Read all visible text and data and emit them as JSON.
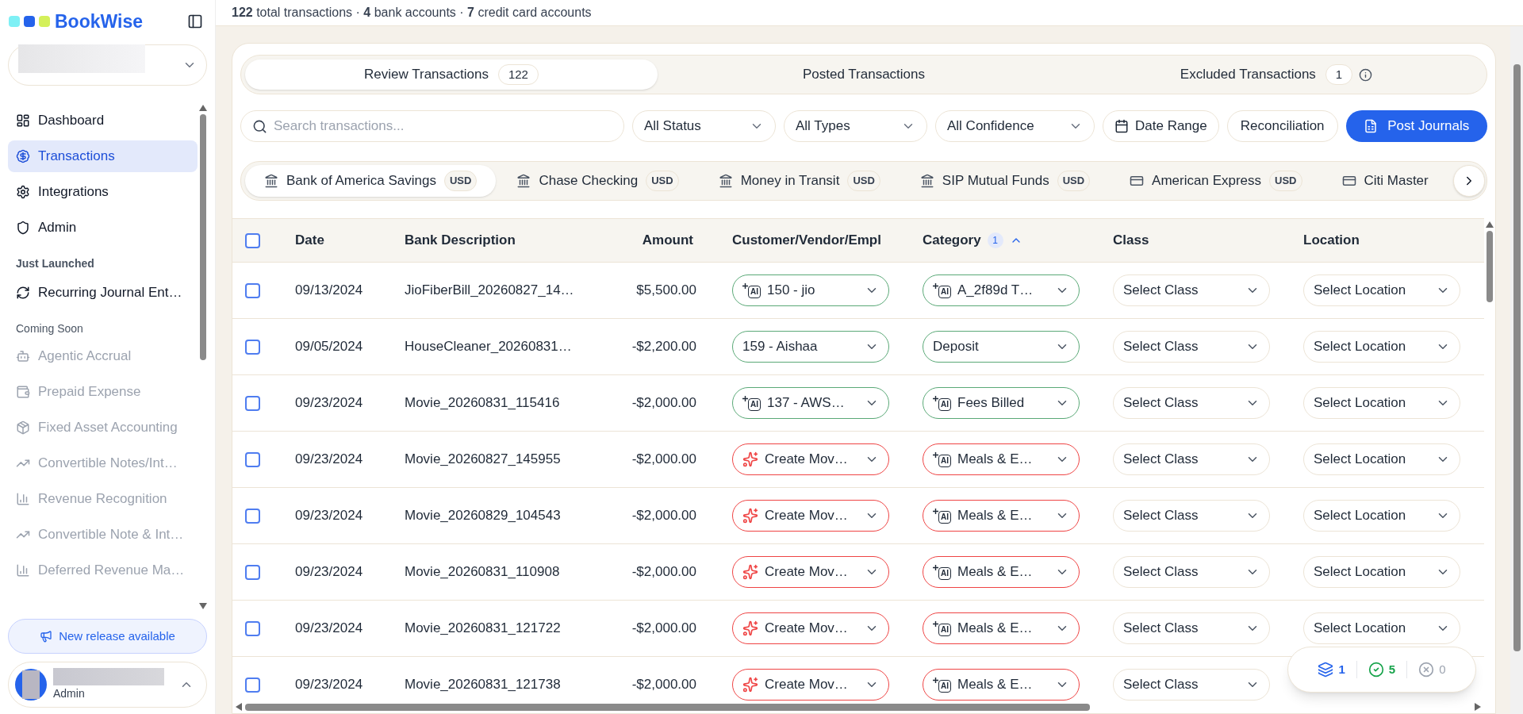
{
  "sidebar": {
    "brand": "BookWise",
    "items": [
      {
        "kind": "link",
        "label": "Dashboard",
        "selected": false,
        "disabled": false
      },
      {
        "kind": "link",
        "label": "Transactions",
        "selected": true,
        "disabled": false
      },
      {
        "kind": "link",
        "label": "Integrations",
        "selected": false,
        "disabled": false
      },
      {
        "kind": "link",
        "label": "Admin",
        "selected": false,
        "disabled": false
      },
      {
        "kind": "heading",
        "label": "Just Launched"
      },
      {
        "kind": "link",
        "label": "Recurring Journal Ent…",
        "selected": false,
        "disabled": false
      },
      {
        "kind": "subheading",
        "label": "Coming Soon"
      },
      {
        "kind": "link",
        "label": "Agentic Accrual",
        "selected": false,
        "disabled": true
      },
      {
        "kind": "link",
        "label": "Prepaid Expense",
        "selected": false,
        "disabled": true
      },
      {
        "kind": "link",
        "label": "Fixed Asset Accounting",
        "selected": false,
        "disabled": true
      },
      {
        "kind": "link",
        "label": "Convertible Notes/Int…",
        "selected": false,
        "disabled": true
      },
      {
        "kind": "link",
        "label": "Revenue Recognition",
        "selected": false,
        "disabled": true
      },
      {
        "kind": "link",
        "label": "Convertible Note & Int…",
        "selected": false,
        "disabled": true
      },
      {
        "kind": "link",
        "label": "Deferred Revenue Ma…",
        "selected": false,
        "disabled": true
      }
    ],
    "release_button": "New release available",
    "user": {
      "role": "Admin"
    }
  },
  "summary": "**122** total transactions · **4** bank accounts · **7** credit card accounts",
  "tabs": [
    {
      "label": "Review Transactions",
      "count": "122",
      "selected": true
    },
    {
      "label": "Posted Transactions",
      "selected": false
    },
    {
      "label": "Excluded Transactions",
      "count": "1",
      "selected": false
    }
  ],
  "search": {
    "placeholder": "Search transactions..."
  },
  "filters": [
    "All Status",
    "All Types",
    "All Confidence"
  ],
  "buttons": [
    "Date Range",
    "Reconciliation",
    "Post Journals"
  ],
  "accounts": [
    {
      "kind": "bank",
      "name": "Bank of America Savings",
      "currency": "USD",
      "selected": true
    },
    {
      "kind": "bank",
      "name": "Chase Checking",
      "currency": "USD",
      "selected": false
    },
    {
      "kind": "bank",
      "name": "Money in Transit",
      "currency": "USD",
      "selected": false
    },
    {
      "kind": "bank",
      "name": "SIP Mutual Funds",
      "currency": "USD",
      "selected": false
    },
    {
      "kind": "card",
      "name": "American Express",
      "currency": "USD",
      "selected": false
    },
    {
      "kind": "card",
      "name": "Citi Master",
      "selected": false
    }
  ],
  "table": {
    "select_all_checked": false,
    "columns": [
      {
        "label": "Date"
      },
      {
        "label": "Bank Description"
      },
      {
        "label": "Amount"
      },
      {
        "label": "Customer/Vendor/Empl"
      },
      {
        "label": "Category",
        "badge": "1",
        "sort_ascending": true
      },
      {
        "label": "Class"
      },
      {
        "label": "Location"
      }
    ],
    "rows": [
      {
        "checked": false,
        "date": "09/13/2024",
        "description": "JioFiberBill_20260827_14…",
        "amount": "$5,500.00",
        "customer": {
          "kind": "ai",
          "icon_label": "AI",
          "matched": true,
          "text": "150 - jio"
        },
        "category": {
          "kind": "ai",
          "icon_label": "AI",
          "matched": true,
          "text": "A_2f89d T…"
        },
        "class": "Select Class",
        "location": "Select Location"
      },
      {
        "checked": false,
        "date": "09/05/2024",
        "description": "HouseCleaner_20260831…",
        "amount": "-$2,200.00",
        "customer": {
          "kind": "plain",
          "matched": true,
          "text": "159 - Aishaa"
        },
        "category": {
          "kind": "plain",
          "matched": true,
          "text": "Deposit"
        },
        "class": "Select Class",
        "location": "Select Location"
      },
      {
        "checked": false,
        "date": "09/23/2024",
        "description": "Movie_20260831_115416",
        "amount": "-$2,000.00",
        "customer": {
          "kind": "ai",
          "icon_label": "AI",
          "matched": true,
          "text": "137 - AWS…"
        },
        "category": {
          "kind": "ai",
          "icon_label": "AI",
          "matched": true,
          "text": "Fees Billed"
        },
        "class": "Select Class",
        "location": "Select Location"
      },
      {
        "checked": false,
        "date": "09/23/2024",
        "description": "Movie_20260827_145955",
        "amount": "-$2,000.00",
        "customer": {
          "kind": "create",
          "matched": false,
          "text": "Create Mov…"
        },
        "category": {
          "kind": "ai",
          "icon_label": "AI",
          "matched": false,
          "text": "Meals & E…"
        },
        "class": "Select Class",
        "location": "Select Location"
      },
      {
        "checked": false,
        "date": "09/23/2024",
        "description": "Movie_20260829_104543",
        "amount": "-$2,000.00",
        "customer": {
          "kind": "create",
          "matched": false,
          "text": "Create Mov…"
        },
        "category": {
          "kind": "ai",
          "icon_label": "AI",
          "matched": false,
          "text": "Meals & E…"
        },
        "class": "Select Class",
        "location": "Select Location"
      },
      {
        "checked": false,
        "date": "09/23/2024",
        "description": "Movie_20260831_110908",
        "amount": "-$2,000.00",
        "customer": {
          "kind": "create",
          "matched": false,
          "text": "Create Mov…"
        },
        "category": {
          "kind": "ai",
          "icon_label": "AI",
          "matched": false,
          "text": "Meals & E…"
        },
        "class": "Select Class",
        "location": "Select Location"
      },
      {
        "checked": false,
        "date": "09/23/2024",
        "description": "Movie_20260831_121722",
        "amount": "-$2,000.00",
        "customer": {
          "kind": "create",
          "matched": false,
          "text": "Create Mov…"
        },
        "category": {
          "kind": "ai",
          "icon_label": "AI",
          "matched": false,
          "text": "Meals & E…"
        },
        "class": "Select Class",
        "location": "Select Location"
      },
      {
        "checked": false,
        "date": "09/23/2024",
        "description": "Movie_20260831_121738",
        "amount": "-$2,000.00",
        "customer": {
          "kind": "create",
          "matched": false,
          "text": "Create Mov…"
        },
        "category": {
          "kind": "ai",
          "icon_label": "AI",
          "matched": false,
          "text": "Meals & E…"
        },
        "class": "Select Class"
      }
    ]
  },
  "status_pill": {
    "batches": "1",
    "done": "5",
    "failed": "0"
  }
}
